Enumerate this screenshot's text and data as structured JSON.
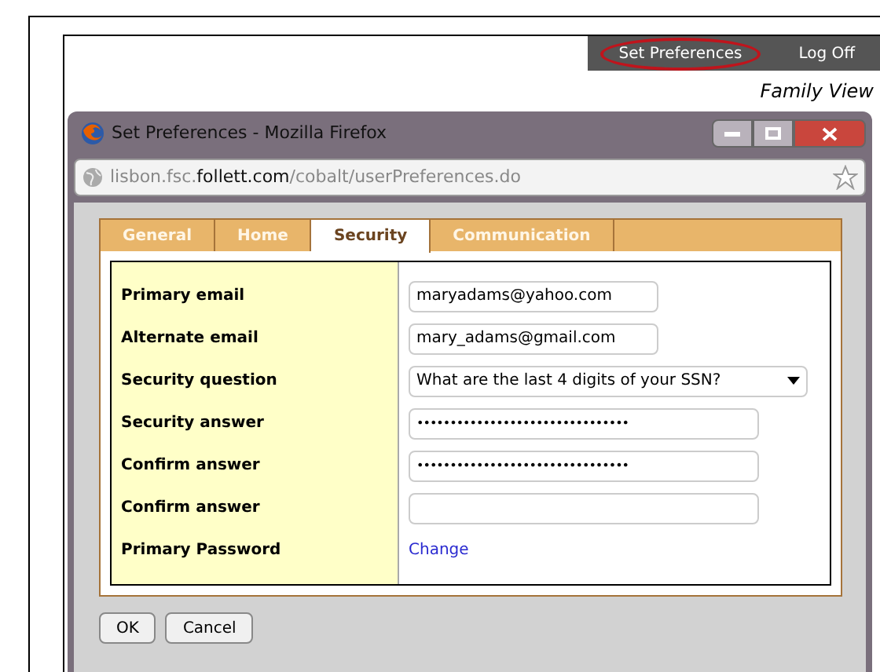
{
  "top_bar": {
    "links": [
      {
        "label": "Set Preferences",
        "highlighted": true
      },
      {
        "label": "Log Off",
        "highlighted": false
      }
    ]
  },
  "view_label": "Family View",
  "window": {
    "title": "Set Preferences - Mozilla Firefox",
    "url": {
      "host_start": "lisbon.fsc.",
      "host_domain": "follett.com",
      "path": "/cobalt/userPreferences.do"
    }
  },
  "tabs": [
    {
      "label": "General",
      "selected": false
    },
    {
      "label": "Home",
      "selected": false
    },
    {
      "label": "Security",
      "selected": true
    },
    {
      "label": "Communication",
      "selected": false
    }
  ],
  "form": [
    {
      "label": "Primary email",
      "kind": "text",
      "value": "maryadams@yahoo.com"
    },
    {
      "label": "Alternate email",
      "kind": "text",
      "value": "mary_adams@gmail.com"
    },
    {
      "label": "Security question",
      "kind": "select",
      "value": "What are the last 4 digits of your SSN?"
    },
    {
      "label": "Security answer",
      "kind": "password",
      "value": "••••••••••••••••••••••••••••••••"
    },
    {
      "label": "Confirm answer",
      "kind": "password",
      "value": "••••••••••••••••••••••••••••••••"
    },
    {
      "label": "Confirm answer",
      "kind": "password"
    },
    {
      "label": "Primary Password",
      "kind": "link",
      "value": "Change"
    }
  ],
  "buttons": [
    "OK",
    "Cancel"
  ]
}
